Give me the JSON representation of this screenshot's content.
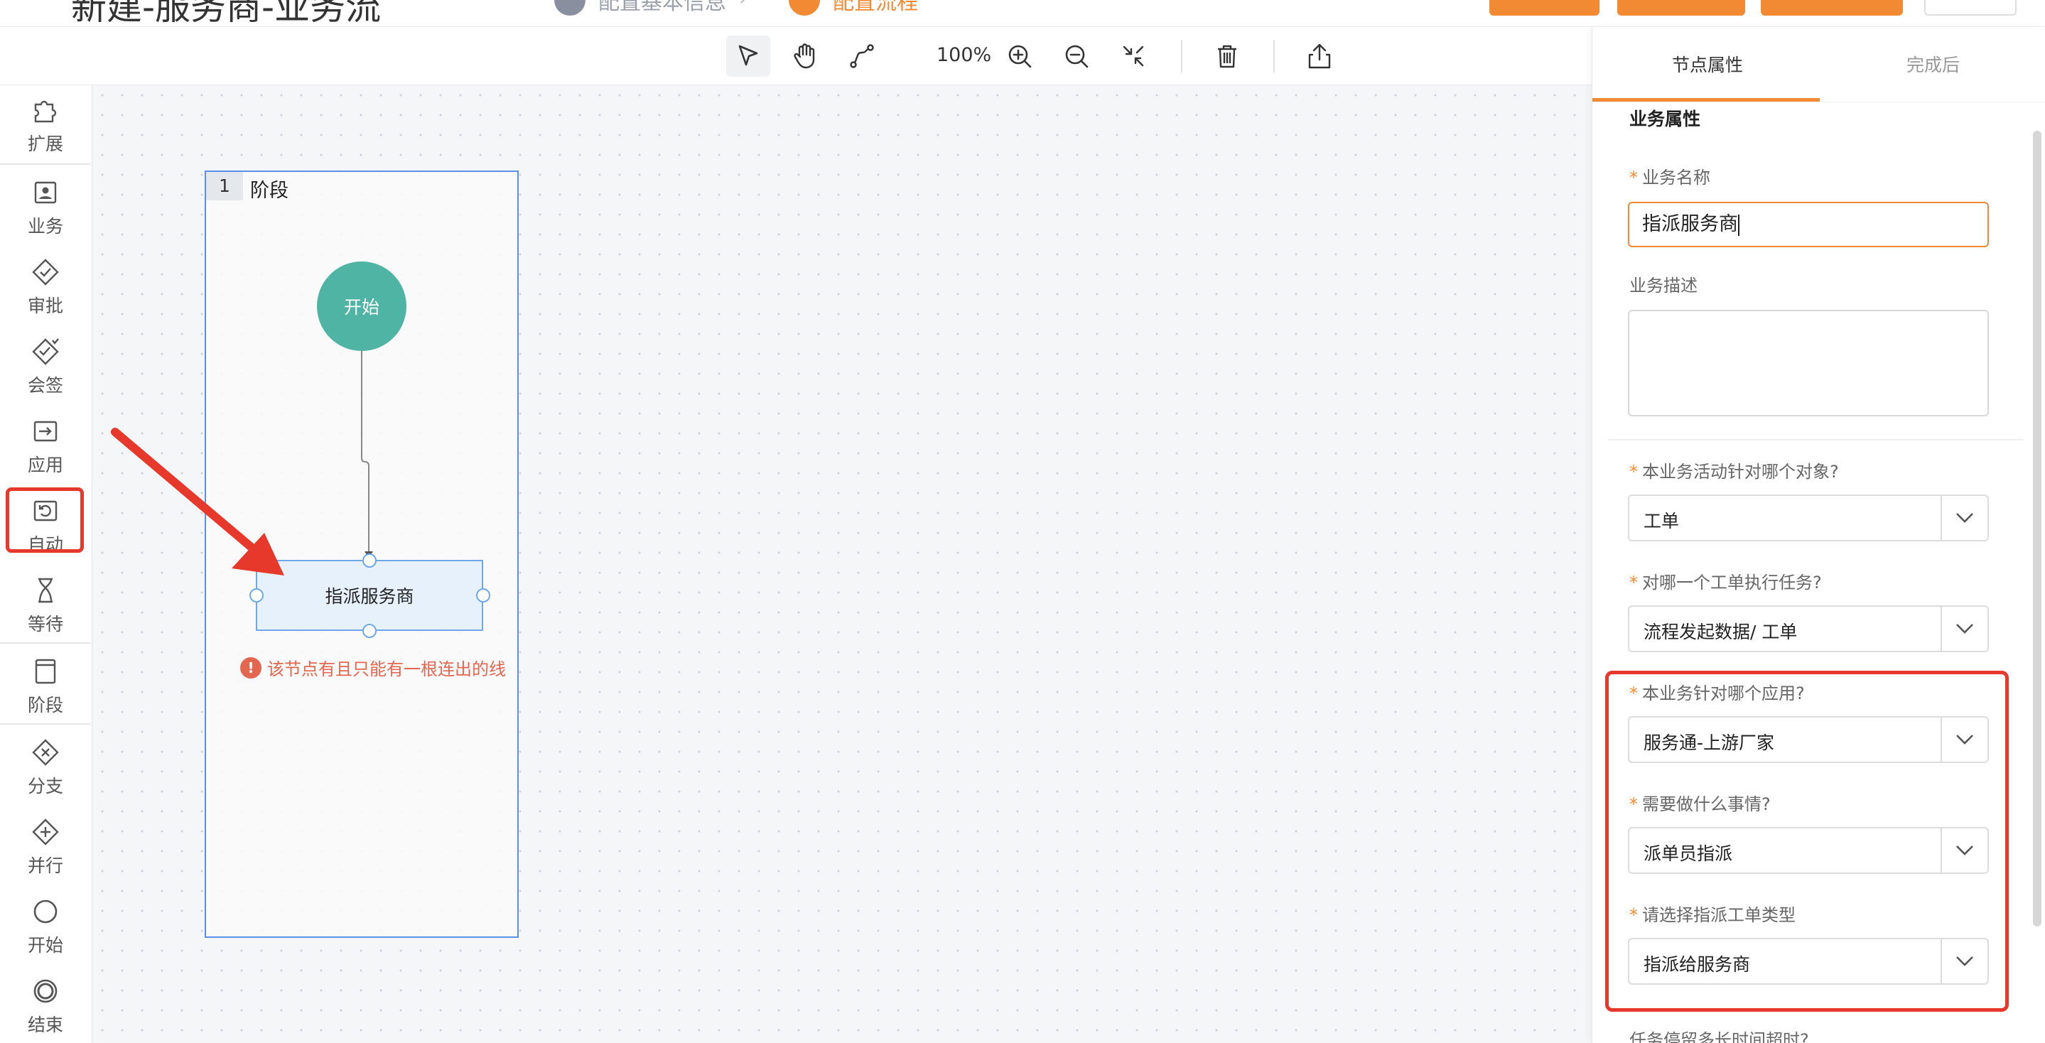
{
  "header": {
    "page_title": "新建-服务商-业务流",
    "step1_label": "配置基本信息",
    "step2_label": "配置流程"
  },
  "toolbar": {
    "zoom": "100%"
  },
  "sidebar": {
    "items": [
      {
        "label": "扩展",
        "icon": "puzzle-icon"
      },
      {
        "label": "业务",
        "icon": "user-task-icon"
      },
      {
        "label": "审批",
        "icon": "diamond-check-icon"
      },
      {
        "label": "会签",
        "icon": "diamond-multi-check-icon"
      },
      {
        "label": "应用",
        "icon": "app-arrow-icon"
      },
      {
        "label": "自动",
        "icon": "auto-loop-icon"
      },
      {
        "label": "等待",
        "icon": "hourglass-icon"
      },
      {
        "label": "阶段",
        "icon": "stage-icon"
      },
      {
        "label": "分支",
        "icon": "diamond-x-icon"
      },
      {
        "label": "并行",
        "icon": "diamond-plus-icon"
      },
      {
        "label": "开始",
        "icon": "circle-icon"
      },
      {
        "label": "结束",
        "icon": "double-circle-icon"
      }
    ]
  },
  "canvas": {
    "stage_number": "1",
    "stage_label": "阶段",
    "start_node_label": "开始",
    "task_node_label": "指派服务商",
    "error_message": "该节点有且只能有一根连出的线"
  },
  "panel": {
    "tab_active": "节点属性",
    "tab_other": "完成后",
    "section_title": "业务属性",
    "name_label": "业务名称",
    "name_value": "指派服务商",
    "desc_label": "业务描述",
    "fields": [
      {
        "label": "本业务活动针对哪个对象?",
        "value": "工单"
      },
      {
        "label": "对哪一个工单执行任务?",
        "value": "流程发起数据/ 工单"
      },
      {
        "label": "本业务针对哪个应用?",
        "value": "服务通-上游厂家"
      },
      {
        "label": "需要做什么事情?",
        "value": "派单员指派"
      },
      {
        "label": "请选择指派工单类型",
        "value": "指派给服务商"
      }
    ],
    "next_label": "任务停留多长时间超时?"
  },
  "colors": {
    "accent": "#f28a33",
    "highlight": "#e6392b",
    "start_node": "#4fb4a4",
    "stage_border": "#5b8fe8"
  }
}
